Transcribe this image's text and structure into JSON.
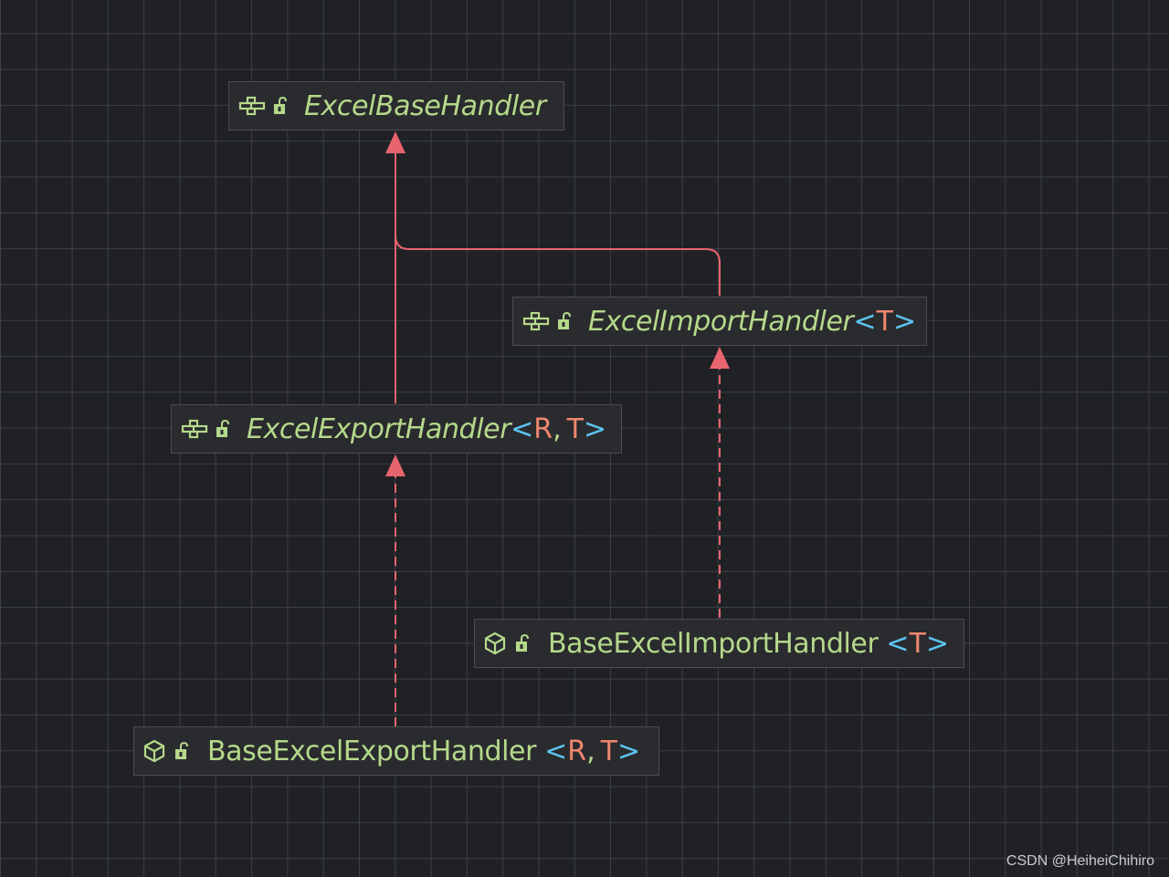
{
  "nodes": {
    "excel_base_handler": {
      "name": "ExcelBaseHandler",
      "kind": "interface",
      "icons": [
        "interface-icon",
        "public-unlock-icon"
      ]
    },
    "excel_import_handler": {
      "name": "ExcelImportHandler",
      "kind": "interface",
      "type_params": [
        "T"
      ],
      "icons": [
        "interface-icon",
        "public-unlock-icon"
      ]
    },
    "excel_export_handler": {
      "name": "ExcelExportHandler",
      "kind": "interface",
      "type_params": [
        "R",
        "T"
      ],
      "icons": [
        "interface-icon",
        "public-unlock-icon"
      ]
    },
    "base_excel_import_handler": {
      "name": "BaseExcelImportHandler",
      "kind": "class",
      "type_params": [
        "T"
      ],
      "icons": [
        "class-cube-icon",
        "public-unlock-icon"
      ]
    },
    "base_excel_export_handler": {
      "name": "BaseExcelExportHandler",
      "kind": "class",
      "type_params": [
        "R",
        "T"
      ],
      "icons": [
        "class-cube-icon",
        "public-unlock-icon"
      ]
    }
  },
  "edges": [
    {
      "from": "excel_export_handler",
      "to": "excel_base_handler",
      "style": "solid",
      "relation": "extends"
    },
    {
      "from": "excel_import_handler",
      "to": "excel_base_handler",
      "style": "solid",
      "relation": "extends"
    },
    {
      "from": "base_excel_export_handler",
      "to": "excel_export_handler",
      "style": "dashed",
      "relation": "implements"
    },
    {
      "from": "base_excel_import_handler",
      "to": "excel_import_handler",
      "style": "dashed",
      "relation": "implements"
    }
  ],
  "colors": {
    "background": "#1f2125",
    "grid": "#3c3f44",
    "node_fill": "#2a2b2e",
    "node_border": "#4a4c50",
    "name_text": "#b5d98b",
    "type_param": "#f0876e",
    "angle_bracket": "#5cc3f0",
    "edge": "#e8646e",
    "icon": "#b5d98b"
  },
  "syntax": {
    "open": "<",
    "close": ">",
    "separator": ", "
  },
  "watermark": "CSDN @HeiheiChihiro"
}
